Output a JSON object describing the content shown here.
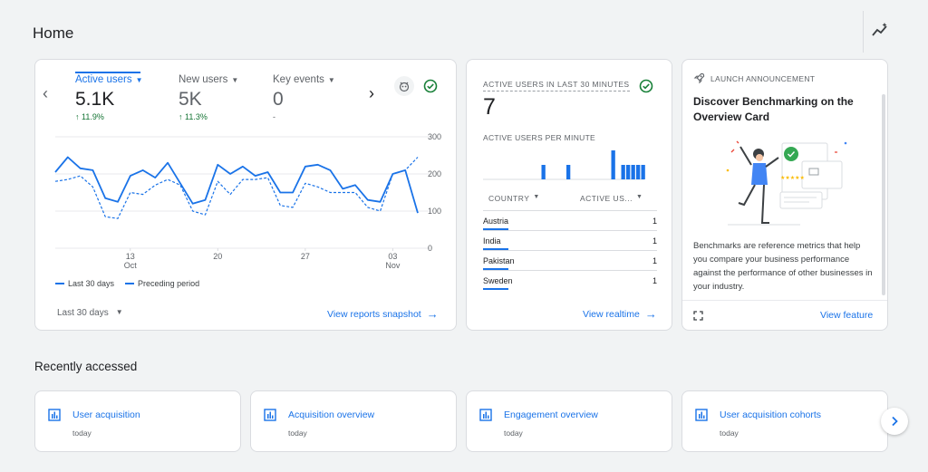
{
  "page": {
    "title": "Home"
  },
  "overview": {
    "metrics": [
      {
        "label": "Active users",
        "value": "5.1K",
        "change": "11.9%",
        "active": true
      },
      {
        "label": "New users",
        "value": "5K",
        "change": "11.3%",
        "active": false
      },
      {
        "label": "Key events",
        "value": "0",
        "change": "-",
        "active": false
      }
    ],
    "legend": {
      "current": "Last 30 days",
      "previous": "Preceding period"
    },
    "date_range": "Last 30 days",
    "link": "View reports snapshot"
  },
  "realtime": {
    "title": "ACTIVE USERS IN LAST 30 MINUTES",
    "value": "7",
    "per_minute_label": "ACTIVE USERS PER MINUTE",
    "col_country": "COUNTRY",
    "col_users": "ACTIVE US...",
    "rows": [
      {
        "country": "Austria",
        "users": "1"
      },
      {
        "country": "India",
        "users": "1"
      },
      {
        "country": "Pakistan",
        "users": "1"
      },
      {
        "country": "Sweden",
        "users": "1"
      }
    ],
    "per_minute_bars": [
      0,
      0,
      0,
      0,
      0,
      0,
      0,
      0,
      0,
      0,
      0,
      1,
      0,
      0,
      0,
      0,
      1,
      0,
      0,
      0,
      0,
      0,
      0,
      0,
      0,
      2,
      0,
      1,
      1,
      1,
      1,
      1
    ],
    "link": "View realtime"
  },
  "announcement": {
    "label": "LAUNCH ANNOUNCEMENT",
    "title": "Discover Benchmarking on the Overview Card",
    "body": "Benchmarks are reference metrics that help you compare your business performance against the performance of other businesses in your industry.",
    "link": "View feature"
  },
  "recent": {
    "title": "Recently accessed",
    "items": [
      {
        "title": "User acquisition",
        "sub": "today"
      },
      {
        "title": "Acquisition overview",
        "sub": "today"
      },
      {
        "title": "Engagement overview",
        "sub": "today"
      },
      {
        "title": "User acquisition cohorts",
        "sub": "today"
      }
    ]
  },
  "chart_data": {
    "type": "line",
    "x_ticks": [
      {
        "day": "13",
        "month": "Oct"
      },
      {
        "day": "20",
        "month": ""
      },
      {
        "day": "27",
        "month": ""
      },
      {
        "day": "03",
        "month": "Nov"
      }
    ],
    "y_ticks": [
      "300",
      "200",
      "100",
      "0"
    ],
    "ylim": [
      0,
      300
    ],
    "series": [
      {
        "name": "Last 30 days",
        "style": "solid",
        "values": [
          205,
          245,
          215,
          210,
          135,
          125,
          195,
          210,
          190,
          230,
          175,
          120,
          130,
          225,
          200,
          220,
          195,
          205,
          150,
          150,
          220,
          225,
          210,
          160,
          170,
          130,
          125,
          200,
          210,
          95
        ]
      },
      {
        "name": "Preceding period",
        "style": "dashed",
        "values": [
          180,
          185,
          195,
          165,
          85,
          80,
          150,
          145,
          170,
          185,
          170,
          100,
          90,
          180,
          145,
          185,
          185,
          190,
          115,
          110,
          175,
          165,
          150,
          150,
          150,
          110,
          100,
          200,
          210,
          245
        ]
      }
    ]
  }
}
